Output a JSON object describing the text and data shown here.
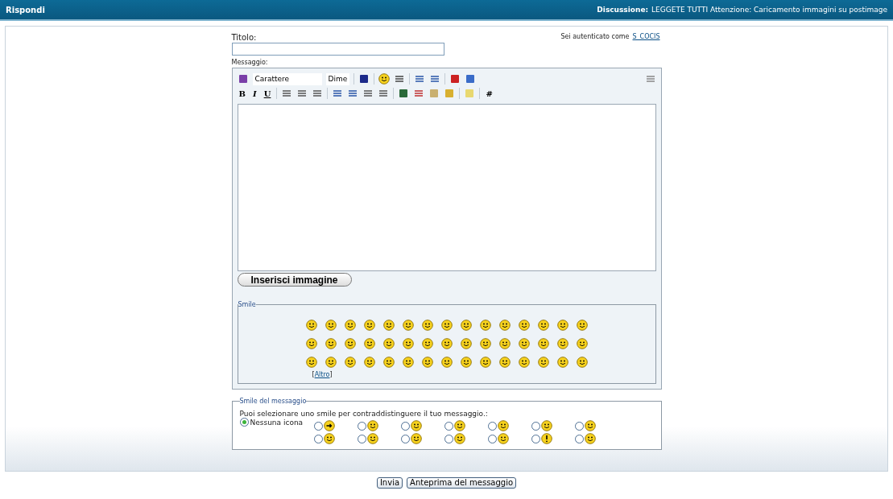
{
  "header": {
    "title": "Rispondi",
    "discussion_label": "Discussione:",
    "discussion_title": "LEGGETE TUTTI Attenzione: Caricamento immagini su postimage"
  },
  "form": {
    "title_label": "Titolo:",
    "auth_text": "Sei autenticato come",
    "user": "S_COCIS",
    "message_label": "Messaggio:"
  },
  "toolbar": {
    "font_select": "Carattere",
    "size_select": "Dime",
    "format_buttons": [
      {
        "label": "B",
        "kind": "bold"
      },
      {
        "label": "I",
        "kind": "italic"
      },
      {
        "label": "U",
        "kind": "underline"
      }
    ],
    "hash_button": "#"
  },
  "insert_image_button": "Inserisci immagine",
  "smile_panel": {
    "legend": "Smile",
    "more_open": "[",
    "more_link": "Altro",
    "more_close": "]"
  },
  "message_icon_panel": {
    "legend": "Smile del messaggio",
    "instruction": "Puoi selezionare uno smile per contraddistinguere il tuo messaggio.:",
    "none_option": {
      "label": "Nessuna icona",
      "selected": true
    },
    "options": [
      {
        "selected": false
      },
      {
        "selected": false
      },
      {
        "selected": false
      },
      {
        "selected": false
      },
      {
        "selected": false
      },
      {
        "selected": false
      },
      {
        "selected": false
      },
      {
        "selected": false
      },
      {
        "selected": false
      },
      {
        "selected": false
      },
      {
        "selected": false
      },
      {
        "selected": false
      },
      {
        "selected": false
      },
      {
        "selected": false
      }
    ]
  },
  "buttons": [
    {
      "label": "Invia"
    },
    {
      "label": "Anteprima del messaggio"
    }
  ]
}
